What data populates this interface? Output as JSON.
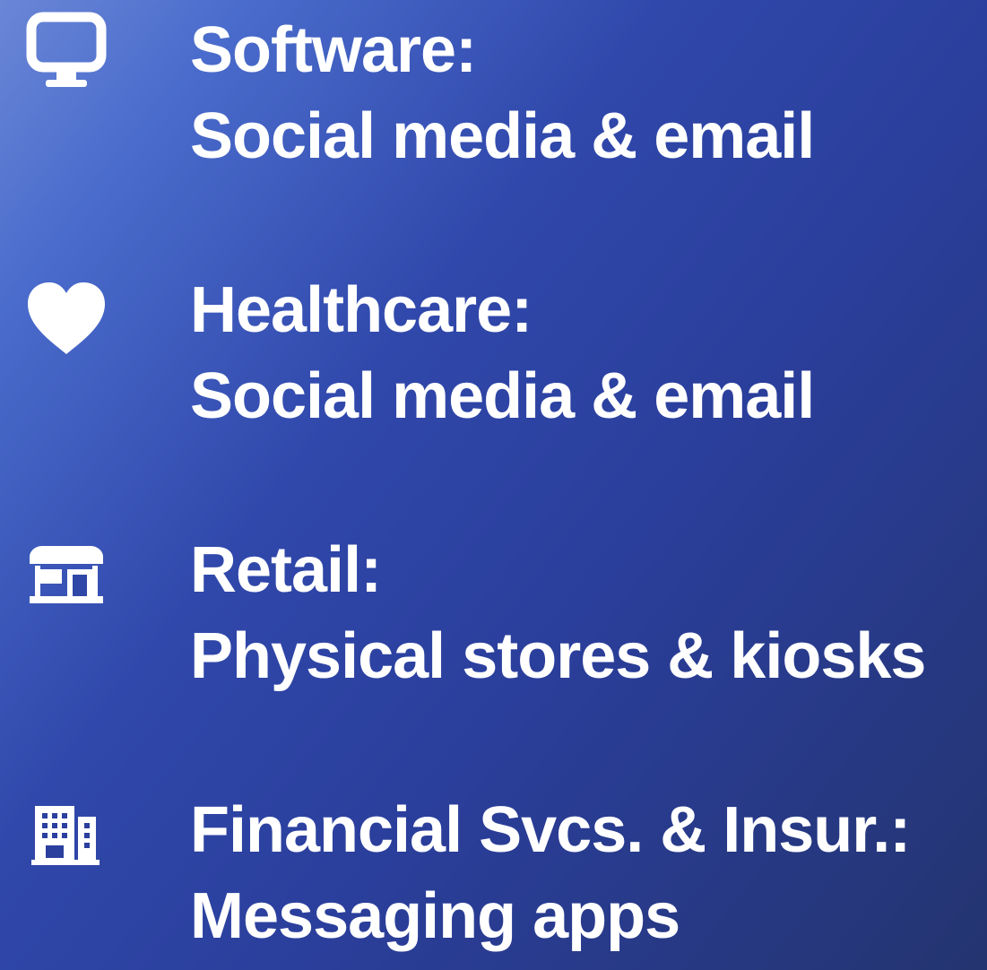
{
  "colors": {
    "text": "#ffffff",
    "icon": "#ffffff",
    "gradient_start": "#6a86d6",
    "gradient_mid": "#3048ab",
    "gradient_end": "#243470"
  },
  "items": [
    {
      "icon": "desktop-monitor-icon",
      "heading": "Software:",
      "channel": "Social media & email"
    },
    {
      "icon": "heart-icon",
      "heading": "Healthcare:",
      "channel": "Social media & email"
    },
    {
      "icon": "storefront-icon",
      "heading": "Retail:",
      "channel": "Physical stores & kiosks"
    },
    {
      "icon": "office-building-icon",
      "heading": "Financial Svcs. & Insur.:",
      "channel": "Messaging apps"
    }
  ]
}
